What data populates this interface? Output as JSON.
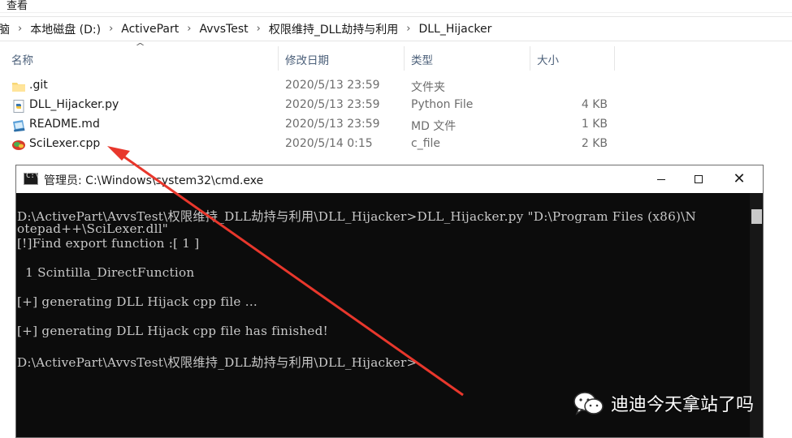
{
  "ribbon": {
    "tab_view": "查看"
  },
  "breadcrumb": [
    "脑",
    "本地磁盘 (D:)",
    "ActivePart",
    "AvvsTest",
    "权限维持_DLL劫持与利用",
    "DLL_Hijacker"
  ],
  "columns": {
    "name": "名称",
    "modified": "修改日期",
    "type": "类型",
    "size": "大小"
  },
  "files": [
    {
      "icon": "folder-icon",
      "name": ".git",
      "modified": "2020/5/13 23:59",
      "type": "文件夹",
      "size": ""
    },
    {
      "icon": "python-file-icon",
      "name": "DLL_Hijacker.py",
      "modified": "2020/5/13 23:59",
      "type": "Python File",
      "size": "4 KB"
    },
    {
      "icon": "markdown-file-icon",
      "name": "README.md",
      "modified": "2020/5/13 23:59",
      "type": "MD 文件",
      "size": "1 KB"
    },
    {
      "icon": "cpp-file-icon",
      "name": "SciLexer.cpp",
      "modified": "2020/5/14 0:15",
      "type": "c_file",
      "size": "2 KB"
    }
  ],
  "cmd": {
    "title": "管理员: C:\\Windows\\system32\\cmd.exe",
    "lines": [
      "D:\\ActivePart\\AvvsTest\\权限维持_DLL劫持与利用\\DLL_Hijacker>DLL_Hijacker.py \"D:\\Program Files (x86)\\N",
      "otepad++\\SciLexer.dll\"",
      "[!]Find export function :[ 1 ]",
      "",
      "  1 Scintilla_DirectFunction",
      "",
      "[+] generating DLL Hijack cpp file ...",
      "",
      "[+] generating DLL Hijack cpp file has finished!",
      "",
      "D:\\ActivePart\\AvvsTest\\权限维持_DLL劫持与利用\\DLL_Hijacker>"
    ]
  },
  "watermark": {
    "text": "迪迪今天拿站了吗",
    "icon": "wechat-icon"
  },
  "colors": {
    "arrow": "#e8372c",
    "console_bg": "#0c0c0c",
    "console_text": "#c8c8c8",
    "header_text": "#4c607a",
    "muted_text": "#6d6d6d"
  }
}
